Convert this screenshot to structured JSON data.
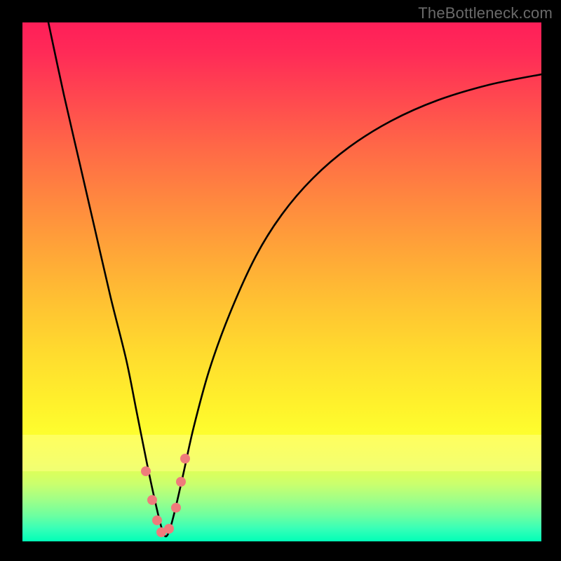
{
  "watermark": {
    "text": "TheBottleneck.com"
  },
  "colors": {
    "dot": "#ef7b7b",
    "curve": "#000000",
    "frame": "#000000"
  },
  "chart_data": {
    "type": "line",
    "title": "",
    "xlabel": "",
    "ylabel": "",
    "xlim": [
      0,
      100
    ],
    "ylim": [
      0,
      100
    ],
    "annotations": [],
    "series": [
      {
        "name": "bottleneck-curve",
        "x": [
          5,
          8,
          11,
          14,
          17,
          20,
          22,
          24,
          25.5,
          26.7,
          27.5,
          28.3,
          29.4,
          31,
          33,
          36,
          40,
          45,
          50,
          56,
          63,
          71,
          80,
          90,
          100
        ],
        "y": [
          100,
          86,
          73,
          60,
          47,
          35,
          25,
          15,
          8,
          3,
          1,
          2,
          6,
          13,
          22,
          33,
          44,
          55,
          63,
          70,
          76,
          81,
          85,
          88,
          90
        ]
      }
    ],
    "dots": {
      "name": "highlight-dots",
      "x": [
        23.8,
        25.0,
        25.9,
        26.8,
        28.3,
        29.6,
        30.6,
        31.3
      ],
      "y": [
        13.5,
        8.0,
        4.0,
        1.8,
        2.5,
        6.5,
        11.5,
        16.0
      ]
    },
    "gradient_note": "vertical red→green heat gradient, green at bottom (good), red at top (bad)"
  }
}
